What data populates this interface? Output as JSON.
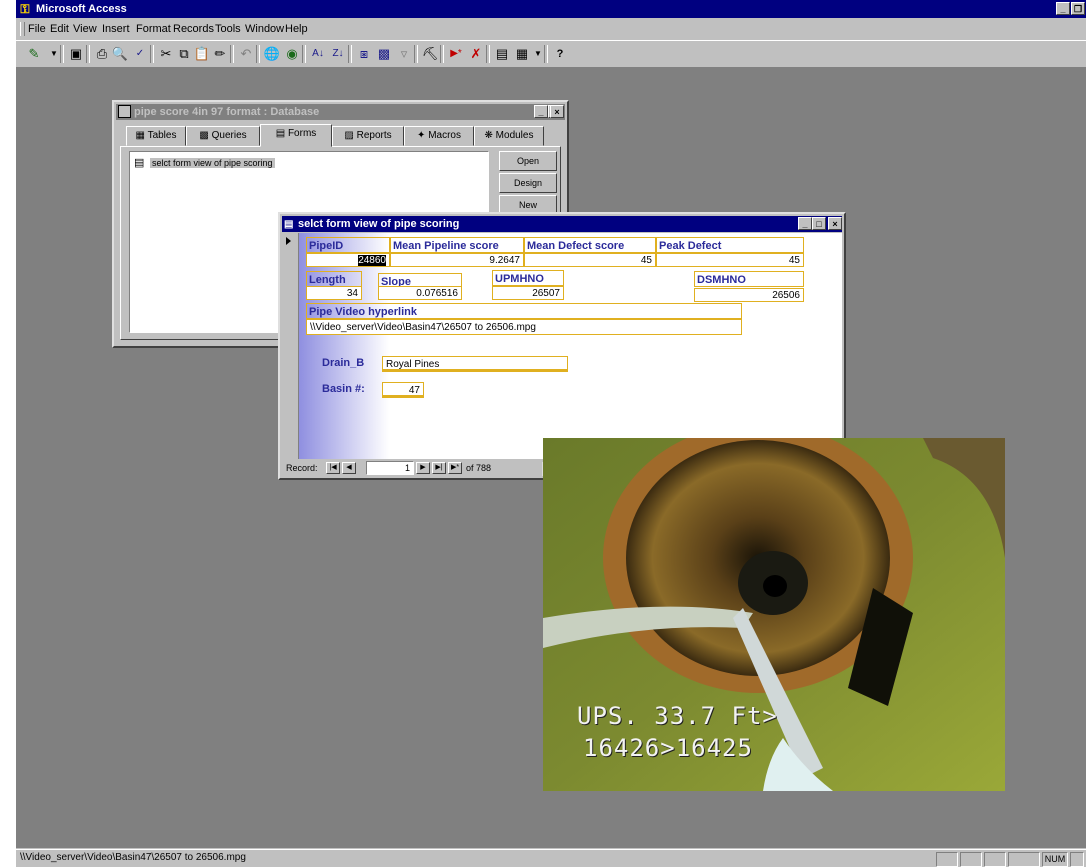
{
  "app": {
    "title": "Microsoft Access",
    "window_buttons": [
      "_",
      "д"
    ]
  },
  "menu": [
    "File",
    "Edit",
    "View",
    "Insert",
    "Format",
    "Records",
    "Tools",
    "Window",
    "Help"
  ],
  "toolbar_icons": [
    "design-view-icon",
    "save-icon",
    "print-icon",
    "print-preview-icon",
    "spelling-icon",
    "cut-icon",
    "copy-icon",
    "paste-icon",
    "format-painter-icon",
    "undo-icon",
    "insert-hyperlink-icon",
    "web-toolbar-icon",
    "sort-ascending-icon",
    "sort-descending-icon",
    "filter-by-selection-icon",
    "filter-by-form-icon",
    "apply-filter-icon",
    "find-icon",
    "new-record-icon",
    "delete-record-icon",
    "database-window-icon",
    "new-object-icon",
    "help-icon"
  ],
  "db_window": {
    "title": "pipe score 4in 97 format : Database",
    "tabs": [
      "Tables",
      "Queries",
      "Forms",
      "Reports",
      "Macros",
      "Modules"
    ],
    "active_tab": "Forms",
    "items": [
      "selct form view of pipe scoring"
    ],
    "buttons": [
      "Open",
      "Design",
      "New"
    ]
  },
  "form_window": {
    "title": "selct form view of pipe scoring",
    "labels": {
      "pipe_id": "PipeID",
      "mean_pipeline_score": "Mean Pipeline score",
      "mean_defect_score": "Mean Defect score",
      "peak_defect": "Peak Defect",
      "length": "Length",
      "slope": "Slope",
      "upmhno": "UPMHNO",
      "dsmhno": "DSMHNO",
      "pipe_video_hyperlink": "Pipe Video hyperlink",
      "drain_b": "Drain_B",
      "basin": "Basin #:"
    },
    "values": {
      "pipe_id": "24860",
      "mean_pipeline_score": "9.2647",
      "mean_defect_score": "45",
      "peak_defect": "45",
      "length": "34",
      "slope": "0.076516",
      "upmhno": "26507",
      "dsmhno": "26506",
      "pipe_video_hyperlink": "\\\\Video_server\\Video\\Basin47\\26507 to 26506.mpg",
      "drain_b": "Royal Pines",
      "basin": "47"
    },
    "record_nav": {
      "label": "Record:",
      "current": "1",
      "of_text": "of 788"
    }
  },
  "video_overlay": {
    "line1": "UPS.  33.7 Ft>",
    "line2": "16426>16425"
  },
  "status": {
    "text": "\\\\Video_server\\Video\\Basin47\\26507 to 26506.mpg",
    "num_indicator": "NUM"
  }
}
